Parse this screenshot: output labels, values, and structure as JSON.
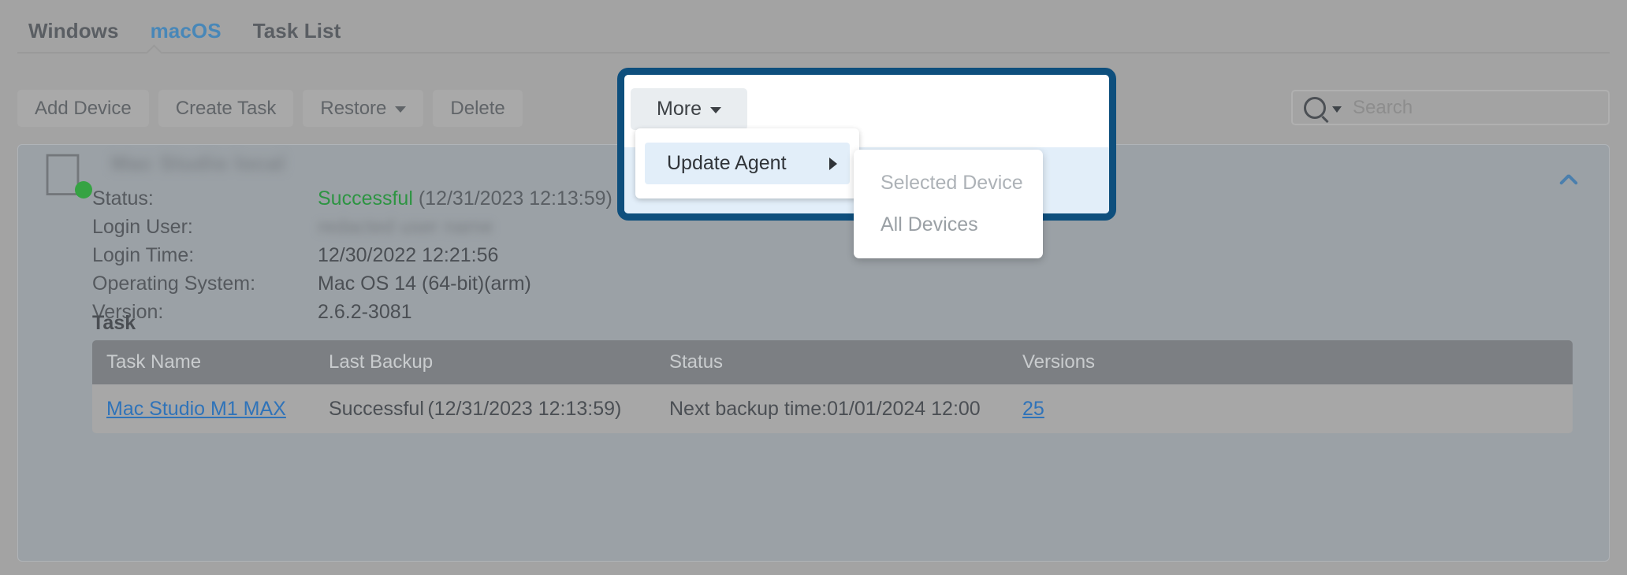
{
  "tabs": [
    {
      "label": "Windows",
      "active": false
    },
    {
      "label": "macOS",
      "active": true
    },
    {
      "label": "Task List",
      "active": false
    }
  ],
  "toolbar": {
    "add_device": "Add Device",
    "create_task": "Create Task",
    "restore": "Restore",
    "delete": "Delete",
    "more": "More"
  },
  "search": {
    "placeholder": "Search",
    "icon": "search-icon"
  },
  "menu": {
    "update_agent": "Update Agent",
    "submenu": [
      {
        "label": "Selected Device",
        "state": "disabled"
      },
      {
        "label": "All Devices",
        "state": "enabled"
      }
    ]
  },
  "device": {
    "name": "Mac Studio local",
    "platform_icon": "apple-icon",
    "online_status": "online",
    "fields": [
      {
        "label": "Status:",
        "value_status": "Successful",
        "value_detail": "(12/31/2023 12:13:59)",
        "type": "status"
      },
      {
        "label": "Login User:",
        "value": "redacted user name",
        "type": "blurred"
      },
      {
        "label": "Login Time:",
        "value": "12/30/2022 12:21:56",
        "type": "plain"
      },
      {
        "label": "Operating System:",
        "value": "Mac OS 14 (64-bit)(arm)",
        "type": "plain"
      },
      {
        "label": "Version:",
        "value": "2.6.2-3081",
        "type": "plain"
      }
    ],
    "collapse_icon": "chevron-up-icon"
  },
  "task_section": {
    "title": "Task",
    "columns": [
      "Task Name",
      "Last Backup",
      "Status",
      "Versions"
    ],
    "rows": [
      {
        "task_name": "Mac Studio M1 MAX",
        "last_backup_status": "Successful",
        "last_backup_time": "(12/31/2023 12:13:59)",
        "status": "Next backup time:01/01/2024 12:00",
        "versions": "25"
      }
    ]
  },
  "colors": {
    "accent_blue": "#4887b8",
    "link_blue": "#2f73b9",
    "success_green": "#2d9442",
    "highlight_border": "#0e4f7d",
    "menu_highlight": "#e2eef9"
  }
}
